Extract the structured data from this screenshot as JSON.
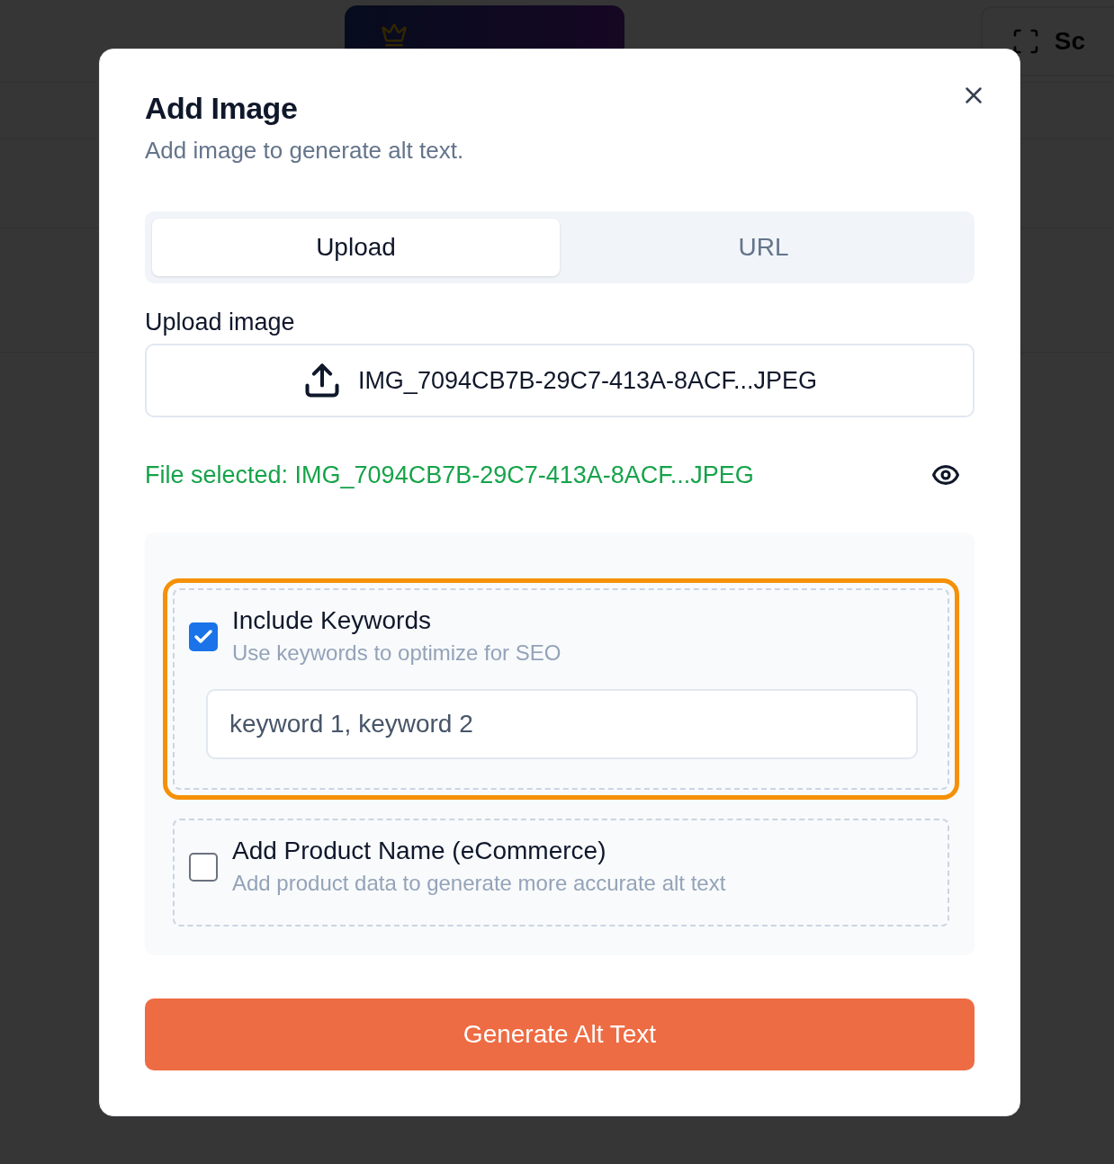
{
  "background": {
    "scan_button": "Sc"
  },
  "dialog": {
    "title": "Add Image",
    "subtitle": "Add image to generate alt text.",
    "tabs": [
      {
        "label": "Upload",
        "selected": true
      },
      {
        "label": "URL",
        "selected": false
      }
    ],
    "upload": {
      "label": "Upload image",
      "file_name": "IMG_7094CB7B-29C7-413A-8ACF...JPEG",
      "status": "File selected: IMG_7094CB7B-29C7-413A-8ACF...JPEG"
    },
    "options": [
      {
        "title": "Include Keywords",
        "description": "Use keywords to optimize for SEO",
        "checked": true,
        "highlighted": true,
        "input": {
          "placeholder": "keyword 1, keyword 2"
        }
      },
      {
        "title": "Add Product Name (eCommerce)",
        "description": "Add product data to generate more accurate alt text",
        "checked": false,
        "highlighted": false
      }
    ],
    "submit": "Generate Alt Text"
  }
}
